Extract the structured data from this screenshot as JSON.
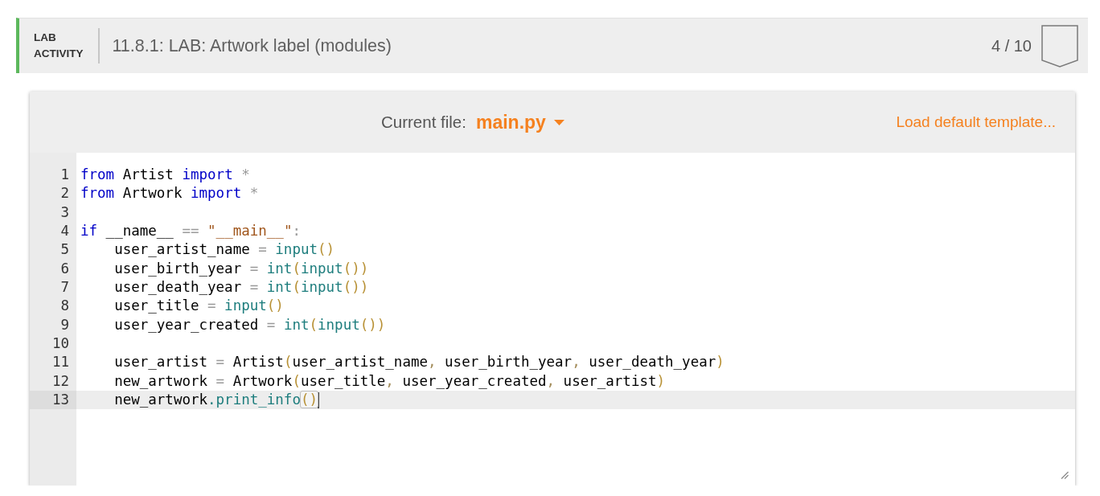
{
  "header": {
    "kind_label": "LAB ACTIVITY",
    "title": "11.8.1: LAB: Artwork label (modules)",
    "score": "4 / 10",
    "badge": {
      "completed": false
    }
  },
  "editor": {
    "file_label": "Current file:",
    "file": {
      "name": "main.py"
    },
    "template_link": "Load default template...",
    "lines": [
      {
        "number": "1",
        "active": false,
        "tokens": [
          {
            "kind": "keyword",
            "text": "from"
          },
          {
            "kind": "plain",
            "text": " Artist "
          },
          {
            "kind": "keyword",
            "text": "import"
          },
          {
            "kind": "operator",
            "text": " *"
          }
        ]
      },
      {
        "number": "2",
        "active": false,
        "tokens": [
          {
            "kind": "keyword",
            "text": "from"
          },
          {
            "kind": "plain",
            "text": " Artwork "
          },
          {
            "kind": "keyword",
            "text": "import"
          },
          {
            "kind": "operator",
            "text": " *"
          }
        ]
      },
      {
        "number": "3",
        "active": false
      },
      {
        "number": "4",
        "active": false,
        "tokens": [
          {
            "kind": "keyword",
            "text": "if"
          },
          {
            "kind": "plain",
            "text": " __name__"
          },
          {
            "kind": "operator",
            "text": " == "
          },
          {
            "kind": "string",
            "text": "\"__main__\""
          },
          {
            "kind": "operator",
            "text": ":"
          }
        ],
        "children": [
          {
            "number": "5",
            "active": false,
            "tokens": [
              {
                "kind": "plain",
                "text": "user_artist_name"
              },
              {
                "kind": "operator",
                "text": " = "
              },
              {
                "kind": "builtin",
                "text": "input"
              },
              {
                "kind": "bracket",
                "text": "()",
                "matched": false
              }
            ]
          },
          {
            "number": "6",
            "active": false,
            "tokens": [
              {
                "kind": "plain",
                "text": "user_birth_year"
              },
              {
                "kind": "operator",
                "text": " = "
              },
              {
                "kind": "builtin",
                "text": "int"
              },
              {
                "kind": "bracket",
                "text": "(",
                "matched": false
              },
              {
                "kind": "builtin",
                "text": "input"
              },
              {
                "kind": "bracket",
                "text": "())",
                "matched": false
              }
            ]
          },
          {
            "number": "7",
            "active": false,
            "tokens": [
              {
                "kind": "plain",
                "text": "user_death_year"
              },
              {
                "kind": "operator",
                "text": " = "
              },
              {
                "kind": "builtin",
                "text": "int"
              },
              {
                "kind": "bracket",
                "text": "(",
                "matched": false
              },
              {
                "kind": "builtin",
                "text": "input"
              },
              {
                "kind": "bracket",
                "text": "())",
                "matched": false
              }
            ]
          },
          {
            "number": "8",
            "active": false,
            "tokens": [
              {
                "kind": "plain",
                "text": "user_title"
              },
              {
                "kind": "operator",
                "text": " = "
              },
              {
                "kind": "builtin",
                "text": "input"
              },
              {
                "kind": "bracket",
                "text": "()",
                "matched": false
              }
            ]
          },
          {
            "number": "9",
            "active": false,
            "tokens": [
              {
                "kind": "plain",
                "text": "user_year_created"
              },
              {
                "kind": "operator",
                "text": " = "
              },
              {
                "kind": "builtin",
                "text": "int"
              },
              {
                "kind": "bracket",
                "text": "(",
                "matched": false
              },
              {
                "kind": "builtin",
                "text": "input"
              },
              {
                "kind": "bracket",
                "text": "())",
                "matched": false
              }
            ]
          },
          {
            "number": "10",
            "active": false
          },
          {
            "number": "11",
            "active": false,
            "tokens": [
              {
                "kind": "plain",
                "text": "user_artist"
              },
              {
                "kind": "operator",
                "text": " = "
              },
              {
                "kind": "plain",
                "text": "Artist"
              },
              {
                "kind": "bracket",
                "text": "(",
                "matched": false
              },
              {
                "kind": "plain",
                "text": "user_artist_name"
              },
              {
                "kind": "punctuation",
                "text": ","
              },
              {
                "kind": "plain",
                "text": " user_birth_year"
              },
              {
                "kind": "punctuation",
                "text": ","
              },
              {
                "kind": "plain",
                "text": " user_death_year"
              },
              {
                "kind": "bracket",
                "text": ")",
                "matched": false
              }
            ]
          },
          {
            "number": "12",
            "active": false,
            "tokens": [
              {
                "kind": "plain",
                "text": "new_artwork"
              },
              {
                "kind": "operator",
                "text": " = "
              },
              {
                "kind": "plain",
                "text": "Artwork"
              },
              {
                "kind": "bracket",
                "text": "(",
                "matched": false
              },
              {
                "kind": "plain",
                "text": "user_title"
              },
              {
                "kind": "punctuation",
                "text": ","
              },
              {
                "kind": "plain",
                "text": " user_year_created"
              },
              {
                "kind": "punctuation",
                "text": ","
              },
              {
                "kind": "plain",
                "text": " user_artist"
              },
              {
                "kind": "bracket",
                "text": ")",
                "matched": false
              }
            ]
          },
          {
            "number": "13",
            "active": true,
            "tokens": [
              {
                "kind": "plain",
                "text": "new_artwork"
              },
              {
                "kind": "builtin",
                "text": ".print_info"
              },
              {
                "kind": "bracket",
                "text": "()",
                "matched": true
              }
            ]
          }
        ]
      }
    ]
  }
}
